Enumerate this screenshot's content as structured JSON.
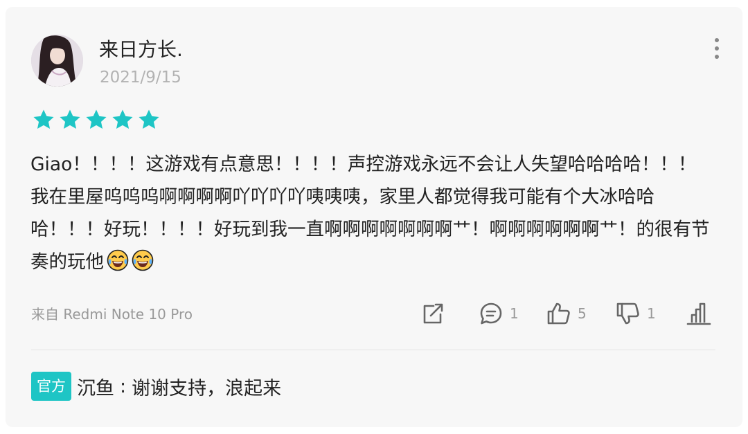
{
  "colors": {
    "accent": "#1ec5c5",
    "card_background": "#f7f7f7",
    "text_primary": "#222222",
    "text_secondary": "#999999"
  },
  "review": {
    "username": "来日方长.",
    "date": "2021/9/15",
    "rating": 5,
    "rating_max": 5,
    "body": "Giao！！！！这游戏有点意思！！！！声控游戏永远不会让人失望哈哈哈哈！！！我在里屋呜呜呜啊啊啊啊吖吖吖吖咦咦咦，家里人都觉得我可能有个大冰哈哈哈！！！好玩！！！！好玩到我一直啊啊啊啊啊啊啊艹！啊啊啊啊啊啊艹！的很有节奏的玩他",
    "emojis": [
      "face-with-tears-of-joy",
      "face-with-tears-of-joy"
    ],
    "device": "来自 Redmi Note 10 Pro"
  },
  "actions": {
    "share": {
      "icon": "share-icon"
    },
    "comment": {
      "icon": "comment-icon",
      "count": "1"
    },
    "like": {
      "icon": "thumbs-up-icon",
      "count": "5"
    },
    "dislike": {
      "icon": "thumbs-down-icon",
      "count": "1"
    },
    "stats": {
      "icon": "bar-chart-icon"
    }
  },
  "reply": {
    "badge": "官方",
    "author": "沉鱼",
    "separator": ":",
    "text": "谢谢支持，浪起来"
  }
}
